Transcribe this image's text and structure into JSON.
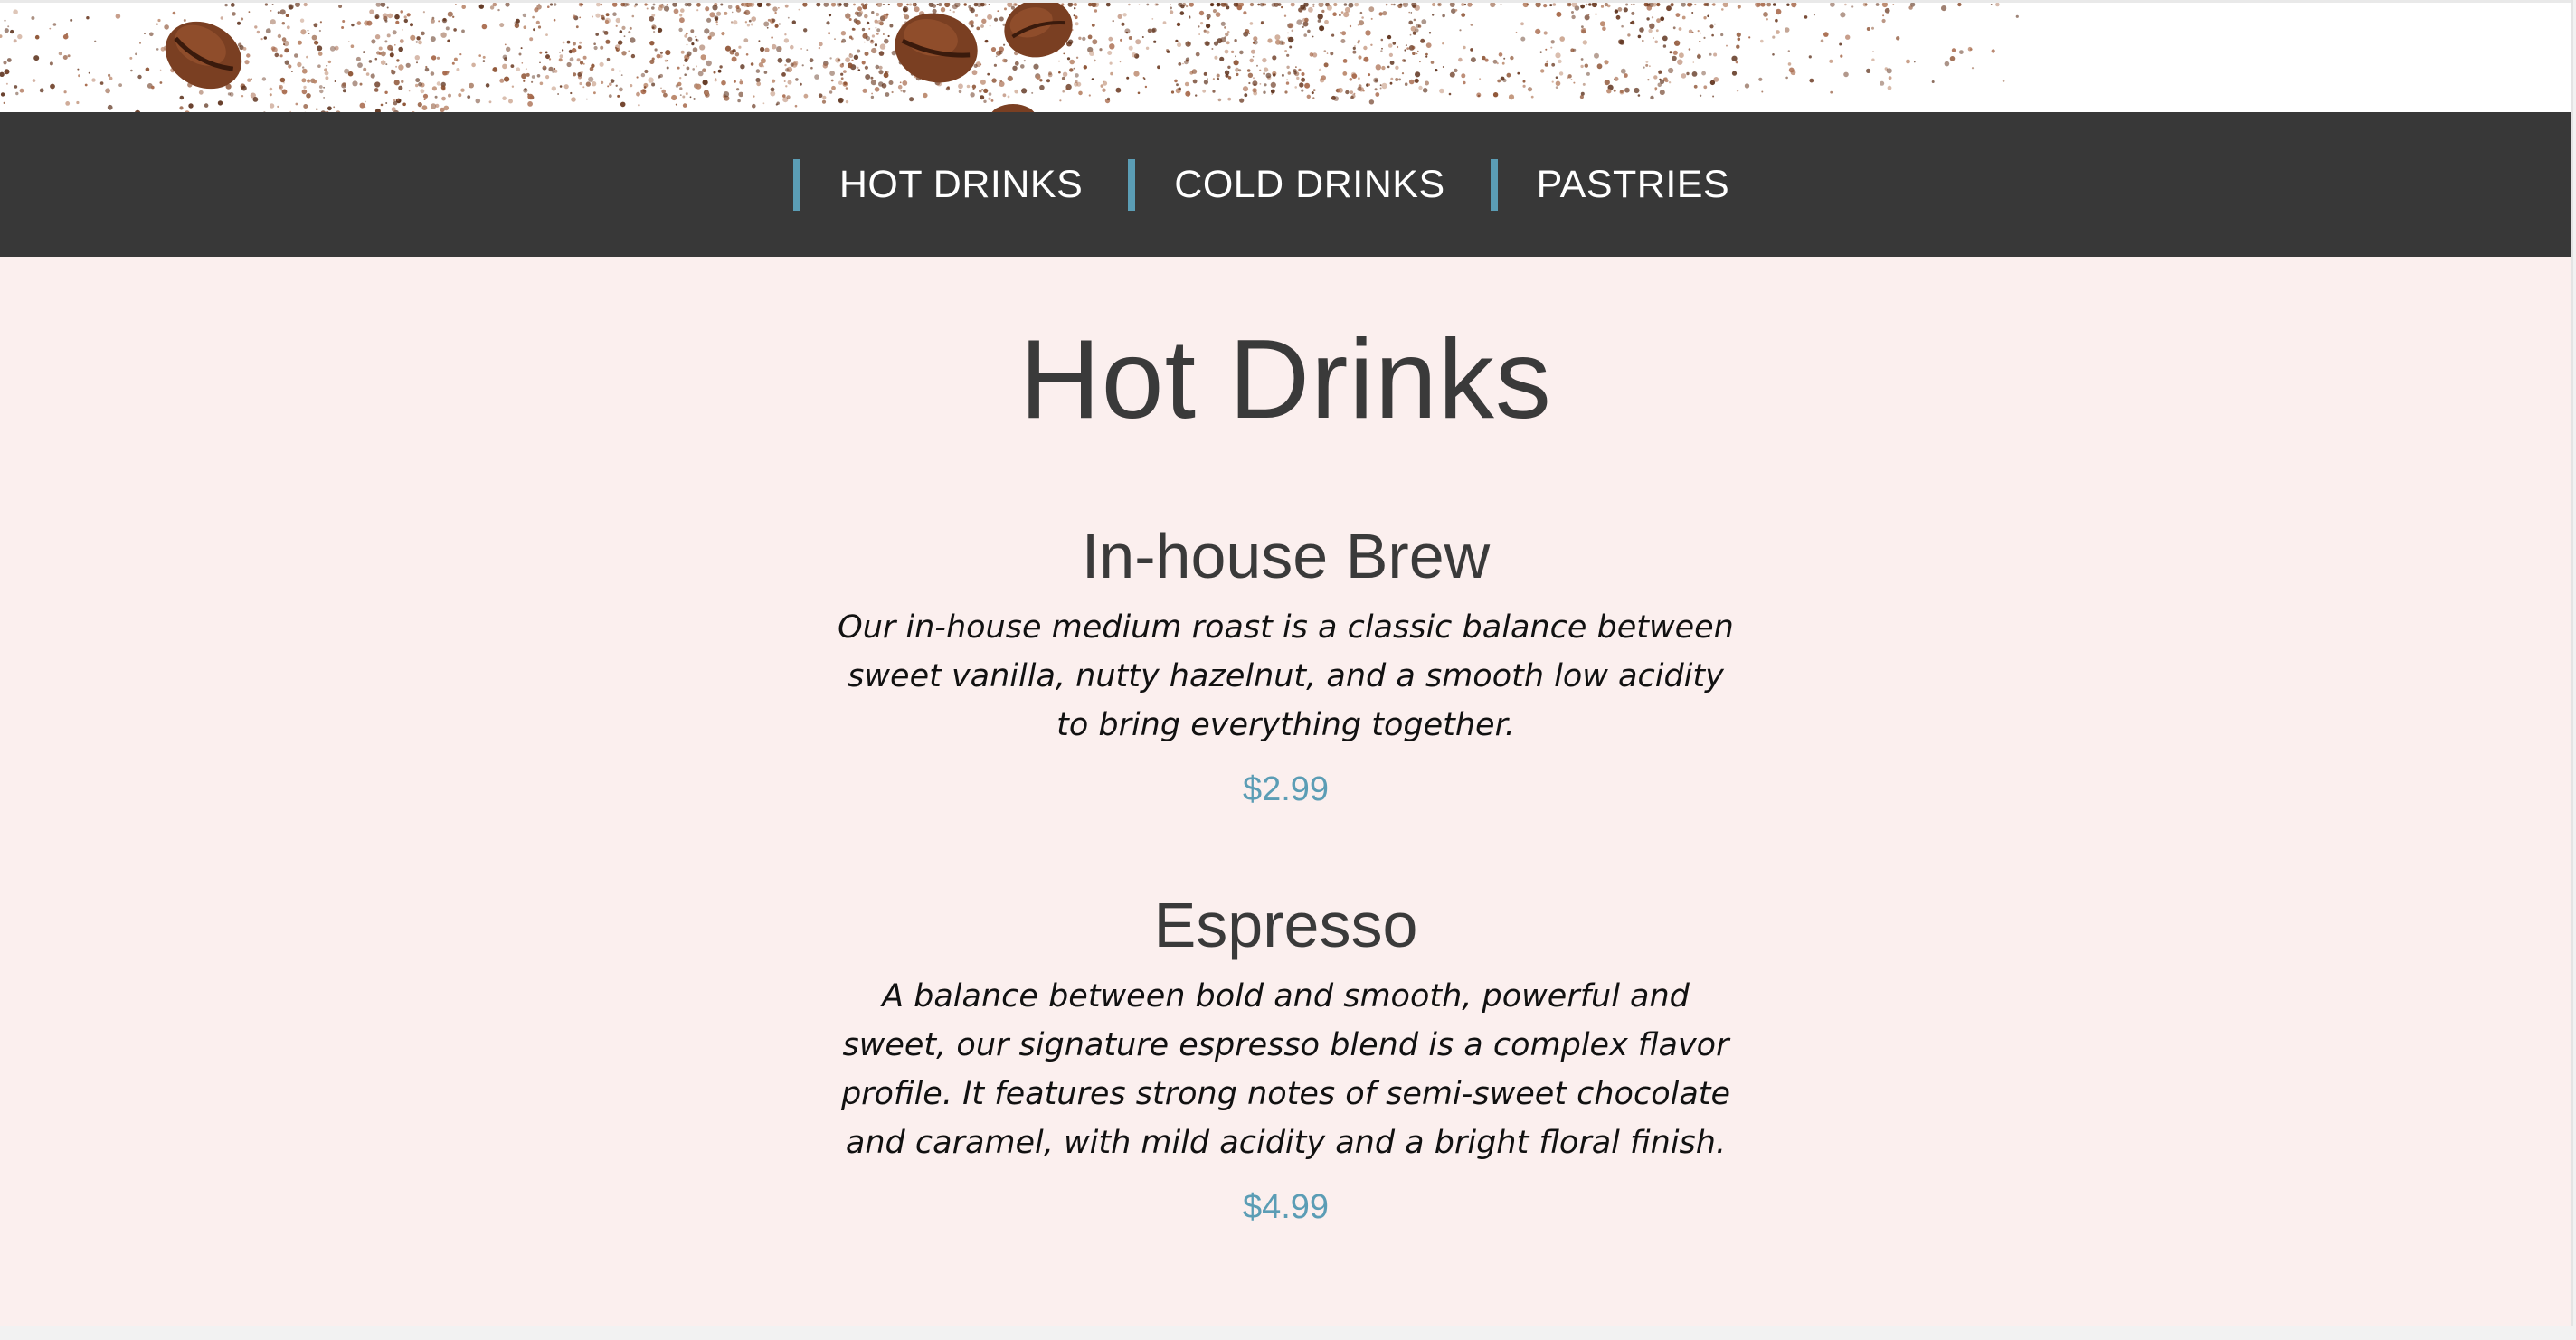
{
  "nav": {
    "items": [
      {
        "label": "HOT DRINKS"
      },
      {
        "label": "COLD DRINKS"
      },
      {
        "label": "PASTRIES"
      }
    ]
  },
  "main": {
    "title": "Hot Drinks",
    "items": [
      {
        "name": "In-house Brew",
        "description": "Our in-house medium roast is a classic balance between sweet vanilla, nutty hazelnut, and a smooth low acidity to bring everything together.",
        "price": "$2.99"
      },
      {
        "name": "Espresso",
        "description": "A balance between bold and smooth, powerful and sweet, our signature espresso blend is a complex flavor profile. It features strong notes of semi-sweet chocolate and caramel, with mild acidity and a bright floral finish.",
        "price": "$4.99"
      }
    ]
  },
  "colors": {
    "nav_background": "#383838",
    "accent": "#5b9db5",
    "page_background": "#fbefee",
    "text": "#3a3a3a"
  },
  "icons": {
    "banner": "coffee-beans-banner-image"
  }
}
